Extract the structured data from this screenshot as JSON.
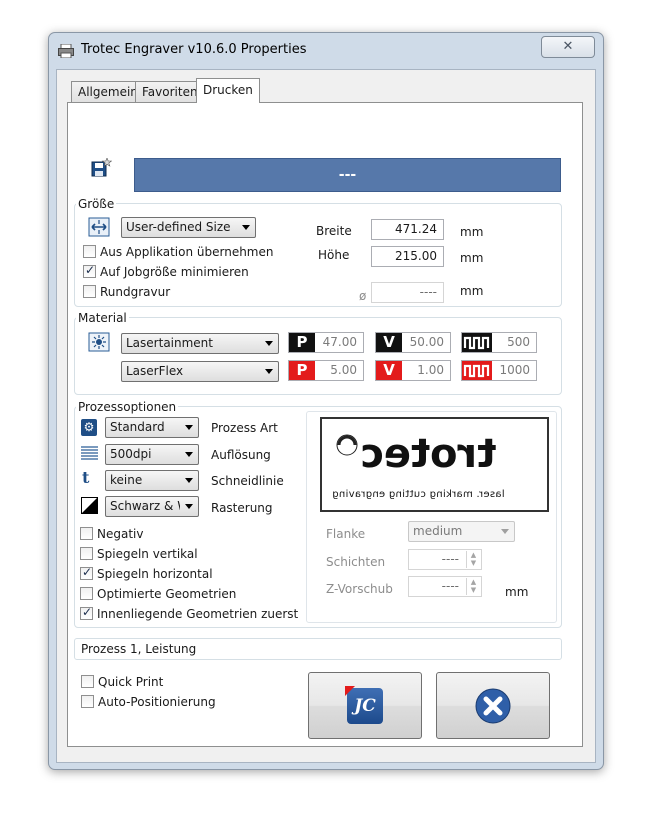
{
  "window": {
    "title": "Trotec Engraver v10.6.0 Properties",
    "close_label": "✕"
  },
  "tabs": [
    {
      "label": "Allgemein",
      "active": false
    },
    {
      "label": "Favoriten",
      "active": false
    },
    {
      "label": "Drucken",
      "active": true
    }
  ],
  "header": {
    "job_bar_text": "---",
    "save_icon": "save-star-icon"
  },
  "groesse": {
    "group_label": "Größe",
    "size_select": "User-defined Size",
    "aus_applikation": {
      "label": "Aus Applikation übernehmen",
      "checked": false
    },
    "minimieren": {
      "label": "Auf Jobgröße minimieren",
      "checked": true
    },
    "rundgravur": {
      "label": "Rundgravur",
      "checked": false
    },
    "breite_label": "Breite",
    "breite_value": "471.24",
    "hoehe_label": "Höhe",
    "hoehe_value": "215.00",
    "diameter_symbol": "ø",
    "diameter_value": "----",
    "unit_mm": "mm"
  },
  "material": {
    "group_label": "Material",
    "category": "Lasertainment",
    "material": "LaserFlex",
    "row1": {
      "p": "47.00",
      "v": "50.00",
      "hz": "500"
    },
    "row2": {
      "p": "5.00",
      "v": "1.00",
      "hz": "1000"
    },
    "p_letter": "P",
    "v_letter": "V"
  },
  "prozess": {
    "group_label": "Prozessoptionen",
    "art_value": "Standard",
    "art_label": "Prozess Art",
    "aufloesung_value": "500dpi",
    "aufloesung_label": "Auflösung",
    "schneidlinie_value": "keine",
    "schneidlinie_label": "Schneidlinie",
    "rasterung_value": "Schwarz & W",
    "rasterung_label": "Rasterung",
    "t_icon_char": "t",
    "checks": [
      {
        "label": "Negativ",
        "checked": false
      },
      {
        "label": "Spiegeln vertikal",
        "checked": false
      },
      {
        "label": "Spiegeln horizontal",
        "checked": true
      },
      {
        "label": "Optimierte Geometrien",
        "checked": false
      },
      {
        "label": "Innenliegende Geometrien zuerst",
        "checked": true
      }
    ],
    "preview_logo": "trotec",
    "preview_tagline": "laser. marking cutting engraving",
    "flanke_label": "Flanke",
    "flanke_value": "medium",
    "schichten_label": "Schichten",
    "schichten_value": "----",
    "zvorschub_label": "Z-Vorschub",
    "zvorschub_value": "----",
    "unit_mm": "mm"
  },
  "status": {
    "text": "Prozess 1, Leistung"
  },
  "bottom": {
    "quick_print": {
      "label": "Quick Print",
      "checked": false
    },
    "auto_pos": {
      "label": "Auto-Positionierung",
      "checked": false
    },
    "jc_text": "JC"
  },
  "colors": {
    "job_bar": "#5678aa",
    "power_red": "#e31b1b",
    "speed_black": "#111111",
    "cancel_blue": "#2f5fa8"
  }
}
